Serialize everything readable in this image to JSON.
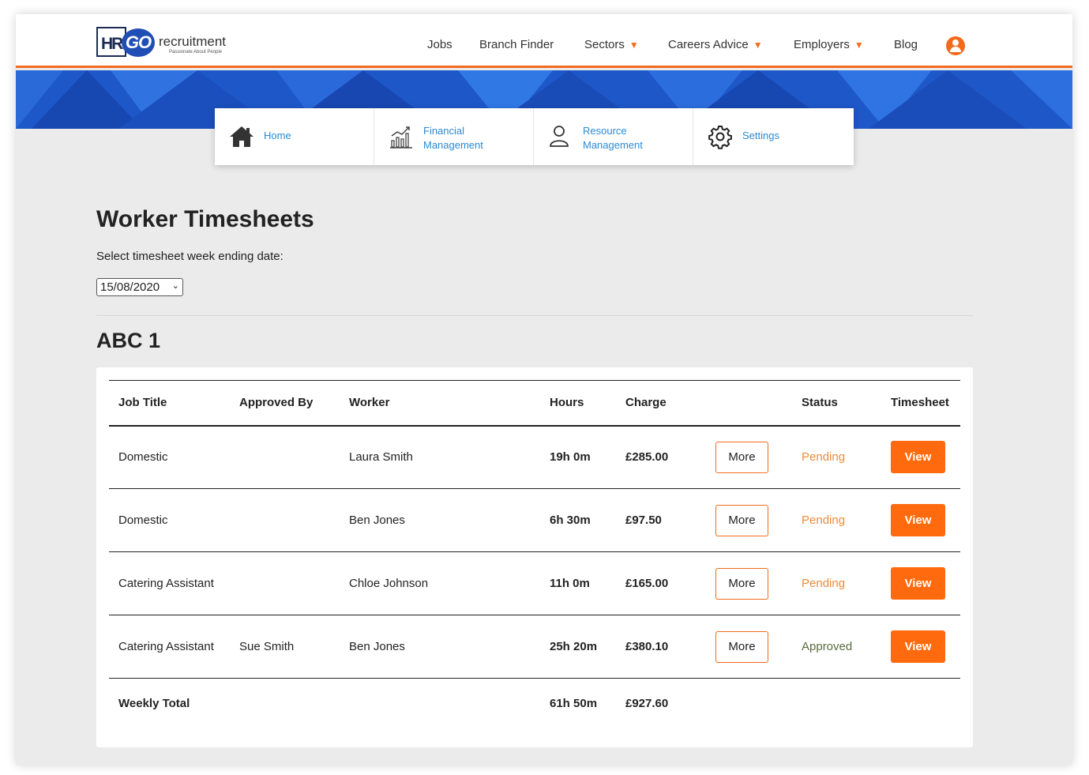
{
  "brand": {
    "logo_hr": "HR",
    "logo_go": "GO",
    "logo_word": "recruitment",
    "logo_tagline": "Passionate About People",
    "accent_color": "#f26b1d",
    "link_color": "#2a8ad4"
  },
  "nav": {
    "items": [
      {
        "label": "Jobs",
        "has_dropdown": false
      },
      {
        "label": "Branch Finder",
        "has_dropdown": false
      },
      {
        "label": "Sectors",
        "has_dropdown": true
      },
      {
        "label": "Careers Advice",
        "has_dropdown": true
      },
      {
        "label": "Employers",
        "has_dropdown": true
      },
      {
        "label": "Blog",
        "has_dropdown": false
      }
    ],
    "dropdown_glyph": "▼",
    "account_icon": "user-icon"
  },
  "quick_menu": [
    {
      "label_line1": "Home",
      "label_line2": "",
      "icon": "home-icon"
    },
    {
      "label_line1": "Financial",
      "label_line2": "Management",
      "icon": "chart-icon"
    },
    {
      "label_line1": "Resource",
      "label_line2": "Management",
      "icon": "person-icon"
    },
    {
      "label_line1": "Settings",
      "label_line2": "",
      "icon": "gear-icon"
    }
  ],
  "page": {
    "title": "Worker Timesheets",
    "select_label": "Select timesheet week ending date:",
    "selected_date": "15/08/2020",
    "company": "ABC 1"
  },
  "table": {
    "headers": [
      "Job Title",
      "Approved By",
      "Worker",
      "Hours",
      "Charge",
      "",
      "Status",
      "Timesheet"
    ],
    "more_label": "More",
    "view_label": "View",
    "rows": [
      {
        "job_title": "Domestic",
        "approved_by": "",
        "worker": "Laura Smith",
        "hours": "19h 0m",
        "charge": "£285.00",
        "status": "Pending"
      },
      {
        "job_title": "Domestic",
        "approved_by": "",
        "worker": "Ben Jones",
        "hours": "6h 30m",
        "charge": "£97.50",
        "status": "Pending"
      },
      {
        "job_title": "Catering Assistant",
        "approved_by": "",
        "worker": "Chloe Johnson",
        "hours": "11h 0m",
        "charge": "£165.00",
        "status": "Pending"
      },
      {
        "job_title": "Catering Assistant",
        "approved_by": "Sue Smith",
        "worker": "Ben Jones",
        "hours": "25h 20m",
        "charge": "£380.10",
        "status": "Approved"
      }
    ],
    "total": {
      "label": "Weekly Total",
      "hours": "61h 50m",
      "charge": "£927.60"
    }
  }
}
